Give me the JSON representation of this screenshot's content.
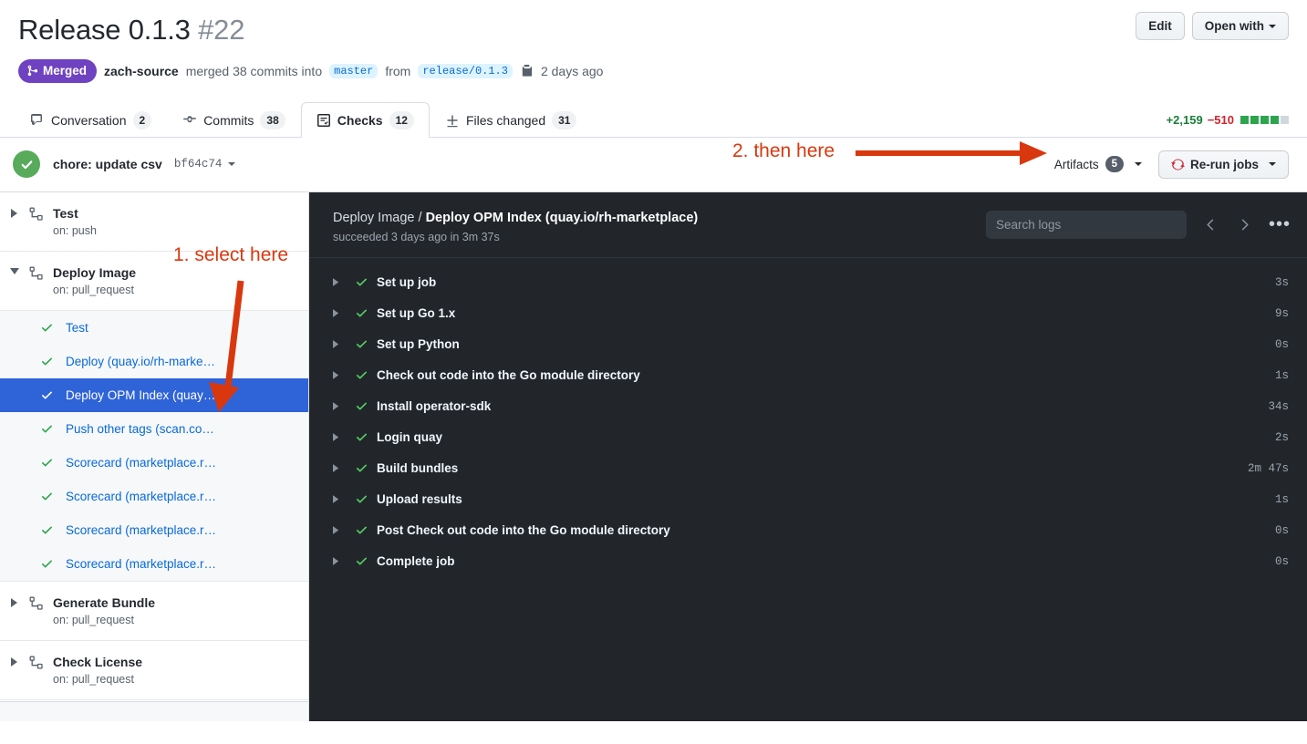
{
  "header": {
    "title": "Release 0.1.3",
    "number": "#22",
    "edit_label": "Edit",
    "open_with_label": "Open with",
    "state_badge": "Merged",
    "author": "zach-source",
    "merged_text": "merged 38 commits into",
    "base_branch": "master",
    "from_text": "from",
    "head_branch": "release/0.1.3",
    "time_ago": "2 days ago"
  },
  "tabs": [
    {
      "label": "Conversation",
      "count": "2",
      "icon": "comment-icon",
      "active": false
    },
    {
      "label": "Commits",
      "count": "38",
      "icon": "commit-icon",
      "active": false
    },
    {
      "label": "Checks",
      "count": "12",
      "icon": "checklist-icon",
      "active": true
    },
    {
      "label": "Files changed",
      "count": "31",
      "icon": "diff-icon",
      "active": false
    }
  ],
  "diffstat": {
    "additions": "+2,159",
    "deletions": "−510",
    "blocks": [
      "g",
      "g",
      "g",
      "g",
      "n"
    ]
  },
  "checks_bar": {
    "commit_message": "chore: update csv",
    "commit_sha": "bf64c74",
    "artifacts_label": "Artifacts",
    "artifacts_count": "5",
    "rerun_label": "Re-run jobs"
  },
  "annotations": [
    {
      "id": "annotation-1",
      "text": "1. select here"
    },
    {
      "id": "annotation-2",
      "text": "2. then here"
    }
  ],
  "sidebar": {
    "workflows": [
      {
        "name": "Test",
        "trigger": "on: push",
        "expanded": false,
        "jobs": []
      },
      {
        "name": "Deploy Image",
        "trigger": "on: pull_request",
        "expanded": true,
        "jobs": [
          {
            "label": "Test",
            "selected": false
          },
          {
            "label": "Deploy (quay.io/rh-marke…",
            "selected": false
          },
          {
            "label": "Deploy OPM Index (quay….",
            "selected": true
          },
          {
            "label": "Push other tags (scan.co…",
            "selected": false
          },
          {
            "label": "Scorecard (marketplace.r…",
            "selected": false
          },
          {
            "label": "Scorecard (marketplace.r…",
            "selected": false
          },
          {
            "label": "Scorecard (marketplace.r…",
            "selected": false
          },
          {
            "label": "Scorecard (marketplace.r…",
            "selected": false
          }
        ]
      },
      {
        "name": "Generate Bundle",
        "trigger": "on: pull_request",
        "expanded": false,
        "jobs": []
      },
      {
        "name": "Check License",
        "trigger": "on: pull_request",
        "expanded": false,
        "jobs": []
      }
    ]
  },
  "logs": {
    "breadcrumb_workflow": "Deploy Image",
    "breadcrumb_separator": " / ",
    "breadcrumb_job": "Deploy OPM Index (quay.io/rh-marketplace)",
    "status_line": "succeeded 3 days ago in 3m 37s",
    "search_placeholder": "Search logs",
    "steps": [
      {
        "name": "Set up job",
        "time": "3s"
      },
      {
        "name": "Set up Go 1.x",
        "time": "9s"
      },
      {
        "name": "Set up Python",
        "time": "0s"
      },
      {
        "name": "Check out code into the Go module directory",
        "time": "1s"
      },
      {
        "name": "Install operator-sdk",
        "time": "34s"
      },
      {
        "name": "Login quay",
        "time": "2s"
      },
      {
        "name": "Build bundles",
        "time": "2m 47s"
      },
      {
        "name": "Upload results",
        "time": "1s"
      },
      {
        "name": "Post Check out code into the Go module directory",
        "time": "0s"
      },
      {
        "name": "Complete job",
        "time": "0s"
      }
    ]
  },
  "colors": {
    "merged_purple": "#6f42c1",
    "selected_blue": "#2f63d8",
    "annotation_red": "#d9380f",
    "success_green": "#2da44e",
    "log_bg": "#22262b"
  }
}
